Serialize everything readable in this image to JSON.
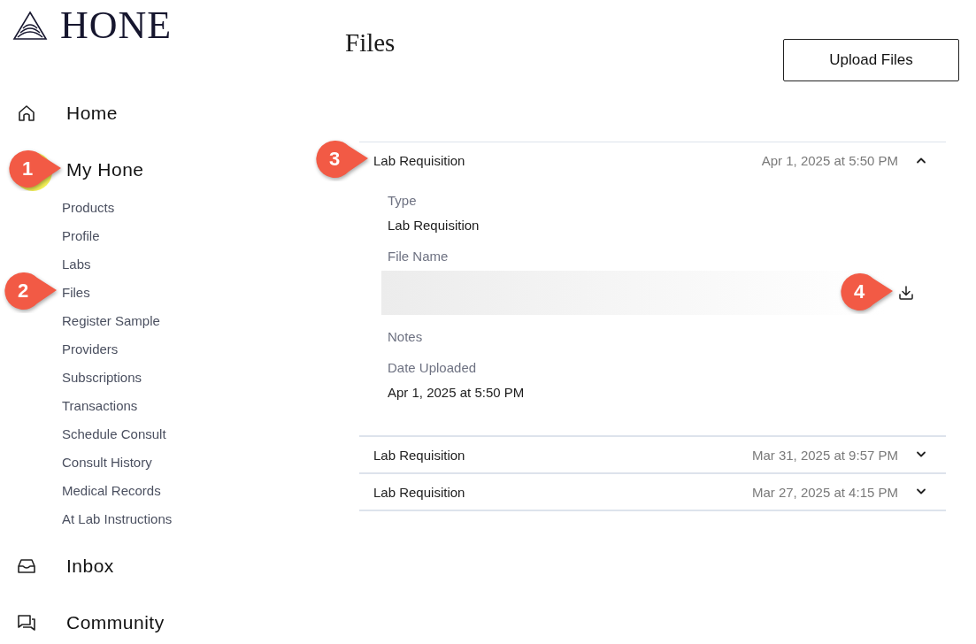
{
  "logo": {
    "text": "HONE"
  },
  "nav": [
    {
      "label": "Home"
    },
    {
      "label": "My Hone",
      "callout": {
        "number": "1",
        "highlight": true
      },
      "children": [
        {
          "label": "Products"
        },
        {
          "label": "Profile"
        },
        {
          "label": "Labs"
        },
        {
          "label": "Files",
          "callout": {
            "number": "2",
            "highlight": false
          }
        },
        {
          "label": "Register Sample"
        },
        {
          "label": "Providers"
        },
        {
          "label": "Subscriptions"
        },
        {
          "label": "Transactions"
        },
        {
          "label": "Schedule Consult"
        },
        {
          "label": "Consult History"
        },
        {
          "label": "Medical Records"
        },
        {
          "label": "At Lab Instructions"
        }
      ]
    },
    {
      "label": "Inbox"
    },
    {
      "label": "Community"
    }
  ],
  "page": {
    "title": "Files",
    "upload_button": "Upload Files"
  },
  "files": [
    {
      "name": "Lab Requisition",
      "date": "Apr 1, 2025 at 5:50 PM",
      "expanded": true,
      "callout": {
        "number": "3",
        "highlight": false
      },
      "details": [
        {
          "kind": "text",
          "label": "Type",
          "value": "Lab Requisition"
        },
        {
          "kind": "file",
          "label": "File Name",
          "callout": {
            "number": "4",
            "highlight": false
          }
        },
        {
          "kind": "text",
          "label": "Notes"
        },
        {
          "kind": "text",
          "label": "Date Uploaded",
          "value": "Apr 1, 2025 at 5:50 PM"
        }
      ]
    },
    {
      "name": "Lab Requisition",
      "date": "Mar 31, 2025 at 9:57 PM",
      "expanded": false
    },
    {
      "name": "Lab Requisition",
      "date": "Mar 27, 2025 at 4:15 PM",
      "expanded": false
    }
  ]
}
